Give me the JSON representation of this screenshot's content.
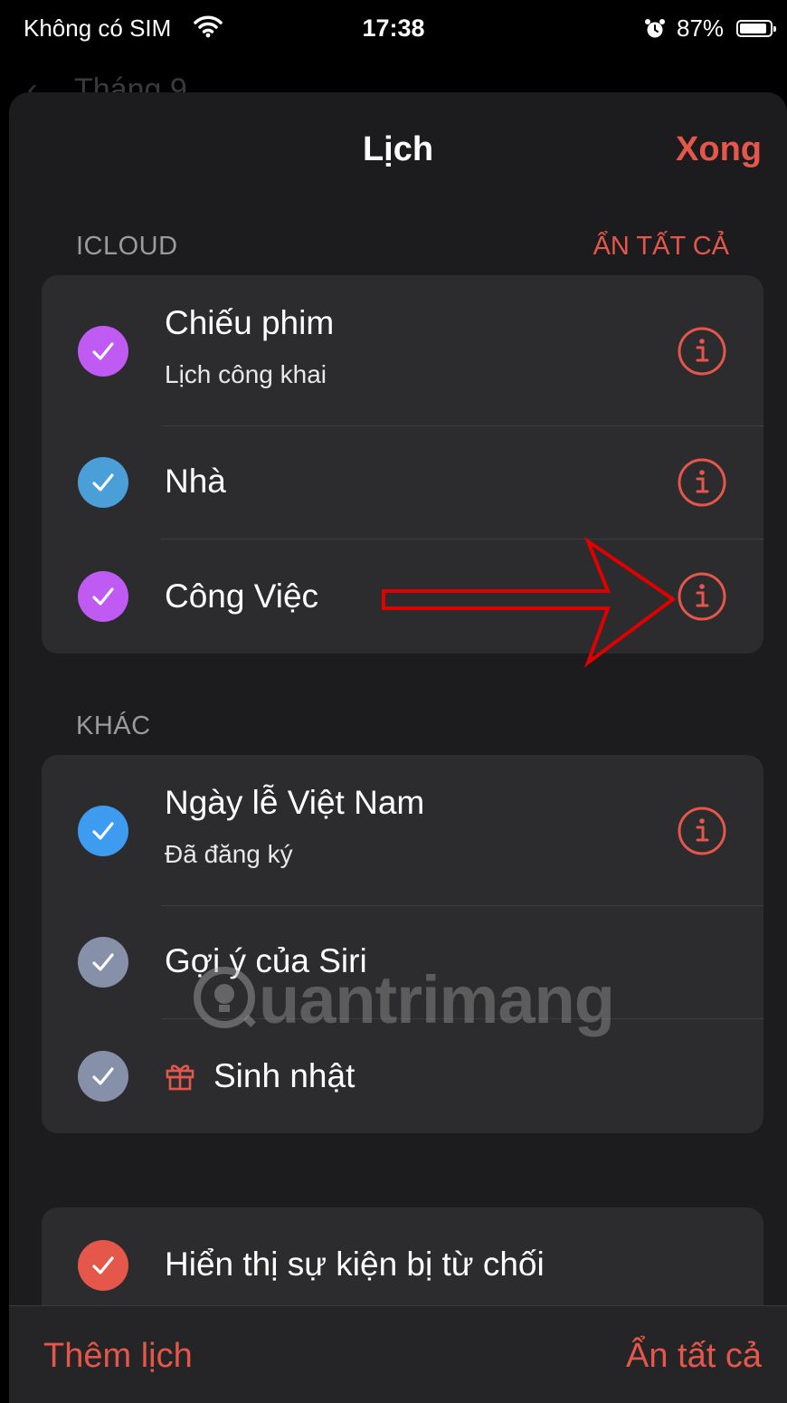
{
  "status_bar": {
    "carrier": "Không có SIM",
    "time": "17:38",
    "battery_percent": "87%",
    "wifi_icon": "wifi-icon",
    "alarm_icon": "alarm-icon"
  },
  "background_nav": {
    "back_label": "Tháng 9"
  },
  "sheet": {
    "title": "Lịch",
    "done_label": "Xong"
  },
  "icloud_section": {
    "label": "ICLOUD",
    "hide_all_label": "ẨN TẤT CẢ",
    "items": [
      {
        "title": "Chiếu phim",
        "subtitle": "Lịch công khai",
        "color": "#bf5af2",
        "checked": true,
        "info_icon": "info-icon"
      },
      {
        "title": "Nhà",
        "subtitle": "",
        "color": "#4b9fd8",
        "checked": true,
        "info_icon": "info-icon"
      },
      {
        "title": "Công Việc",
        "subtitle": "",
        "color": "#bf5af2",
        "checked": true,
        "info_icon": "info-icon"
      }
    ]
  },
  "other_section": {
    "label": "KHÁC",
    "items": [
      {
        "title": "Ngày lễ Việt Nam",
        "subtitle": "Đã đăng ký",
        "color": "#3d9cf0",
        "checked": true,
        "info_icon": "info-icon"
      },
      {
        "title": "Gợi ý của Siri",
        "subtitle": "",
        "color": "#8690a8",
        "checked": true
      },
      {
        "title": "Sinh nhật",
        "subtitle": "",
        "color": "#8690a8",
        "checked": true,
        "icon": "gift-icon"
      }
    ]
  },
  "declined_section": {
    "items": [
      {
        "title": "Hiển thị sự kiện bị từ chối",
        "color": "#e5564b",
        "checked": true
      }
    ]
  },
  "bottom_bar": {
    "add_calendar_label": "Thêm lịch",
    "hide_all_label": "Ẩn tất cả"
  },
  "watermark": {
    "text": "uantrimang"
  },
  "colors": {
    "accent": "#e5564b",
    "sheet_bg": "#1c1c1e",
    "group_bg": "#2c2c2e",
    "annotation_arrow": "#e00000"
  }
}
